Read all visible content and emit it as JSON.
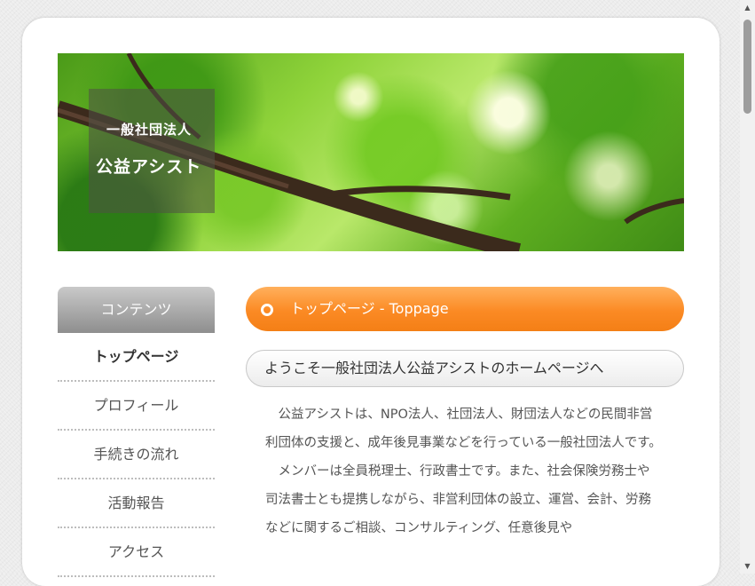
{
  "banner": {
    "org_type": "一般社団法人",
    "org_name": "公益アシスト"
  },
  "sidebar": {
    "heading": "コンテンツ",
    "items": [
      {
        "label": "トップページ",
        "active": true
      },
      {
        "label": "プロフィール",
        "active": false
      },
      {
        "label": "手続きの流れ",
        "active": false
      },
      {
        "label": "活動報告",
        "active": false
      },
      {
        "label": "アクセス",
        "active": false
      }
    ]
  },
  "main": {
    "title": "トップページ - Toppage",
    "subtitle": "ようこそ一般社団法人公益アシストのホームページへ",
    "paragraphs": [
      "公益アシストは、NPO法人、社団法人、財団法人などの民間非営利団体の支援と、成年後見事業などを行っている一般社団法人です。",
      "メンバーは全員税理士、行政書士です。また、社会保険労務士や司法書士とも提携しながら、非営利団体の設立、運営、会計、労務などに関するご相談、コンサルティング、任意後見や"
    ]
  },
  "colors": {
    "accent": "#fb8a24",
    "sidebar_head": "#a8a8a8"
  }
}
